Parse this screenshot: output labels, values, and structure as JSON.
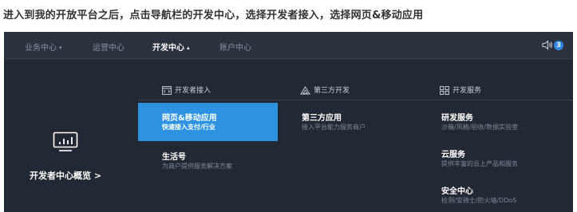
{
  "instruction": "进入到我的开放平台之后，点击导航栏的开发中心，选择开发者接入，选择网页&移动应用",
  "topbar": {
    "nav": [
      {
        "label": "业务中心",
        "has_caret": true,
        "caret": "▾",
        "active": false
      },
      {
        "label": "运营中心",
        "has_caret": false,
        "caret": "",
        "active": false
      },
      {
        "label": "开发中心",
        "has_caret": true,
        "caret": "▴",
        "active": true
      },
      {
        "label": "账户中心",
        "has_caret": false,
        "caret": "",
        "active": false
      }
    ],
    "notification_count": "3"
  },
  "overview": {
    "label": "开发者中心概览 >"
  },
  "columns": [
    {
      "heading": "开发者接入",
      "icon": "code-window-icon",
      "items": [
        {
          "title": "网页&移动应用",
          "desc": "快速接入支付/行业",
          "selected": true
        },
        {
          "title": "生活号",
          "desc": "为商户提供服务解决方案",
          "selected": false
        }
      ]
    },
    {
      "heading": "第三方开发",
      "icon": "triangle-icon",
      "items": [
        {
          "title": "第三方应用",
          "desc": "接入平台能力服务商户",
          "selected": false
        }
      ]
    },
    {
      "heading": "开发服务",
      "icon": "grid-icon",
      "items": [
        {
          "title": "研发服务",
          "desc": "沙箱/风格/验收/数据实验室",
          "selected": false
        },
        {
          "title": "云服务",
          "desc": "提供丰富的云上产品和服务",
          "selected": false
        },
        {
          "title": "安全中心",
          "desc": "检测/安骑士/防火墙/DDoS",
          "selected": false
        }
      ]
    }
  ],
  "colors": {
    "panel_bg": "#2b313d",
    "dropdown_bg": "#232934",
    "accent": "#2d92e0",
    "badge": "#2f8ae6"
  }
}
